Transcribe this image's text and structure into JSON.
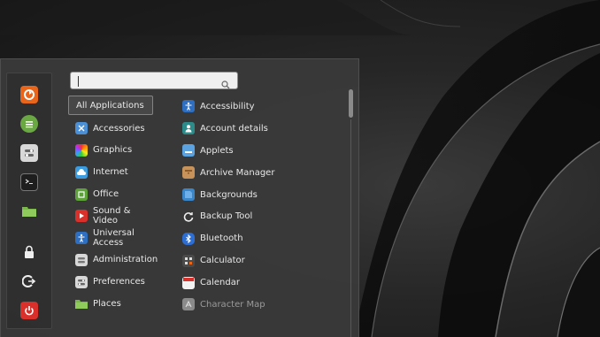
{
  "colors": {
    "mint_orange": "#e8661c",
    "green": "#7bb84b",
    "red": "#d9302b",
    "blue": "#3b85c9"
  },
  "favorites": [
    {
      "name": "firefox",
      "icon": "firefox-icon"
    },
    {
      "name": "software-manager",
      "icon": "software-manager-icon"
    },
    {
      "name": "settings",
      "icon": "toggle-settings-icon"
    },
    {
      "name": "terminal",
      "icon": "terminal-icon"
    },
    {
      "name": "files",
      "icon": "folder-icon"
    },
    {
      "name": "lock-screen",
      "icon": "lock-icon"
    },
    {
      "name": "logout",
      "icon": "logout-icon"
    },
    {
      "name": "shutdown",
      "icon": "power-icon"
    }
  ],
  "search": {
    "value": "",
    "placeholder": ""
  },
  "categories": [
    {
      "label": "All Applications",
      "selected": true
    },
    {
      "label": "Accessories",
      "icon": "accessories-icon"
    },
    {
      "label": "Graphics",
      "icon": "graphics-icon"
    },
    {
      "label": "Internet",
      "icon": "internet-icon"
    },
    {
      "label": "Office",
      "icon": "office-icon"
    },
    {
      "label": "Sound & Video",
      "icon": "sound-video-icon"
    },
    {
      "label": "Universal Access",
      "icon": "universal-access-icon"
    },
    {
      "label": "Administration",
      "icon": "administration-icon"
    },
    {
      "label": "Preferences",
      "icon": "preferences-icon"
    },
    {
      "label": "Places",
      "icon": "places-folder-icon"
    }
  ],
  "applications": [
    {
      "label": "Accessibility",
      "icon": "accessibility-icon"
    },
    {
      "label": "Account details",
      "icon": "account-icon"
    },
    {
      "label": "Applets",
      "icon": "applets-icon"
    },
    {
      "label": "Archive Manager",
      "icon": "archive-icon"
    },
    {
      "label": "Backgrounds",
      "icon": "backgrounds-icon"
    },
    {
      "label": "Backup Tool",
      "icon": "backup-icon"
    },
    {
      "label": "Bluetooth",
      "icon": "bluetooth-icon"
    },
    {
      "label": "Calculator",
      "icon": "calculator-icon"
    },
    {
      "label": "Calendar",
      "icon": "calendar-icon"
    },
    {
      "label": "Character Map",
      "icon": "character-map-icon"
    }
  ]
}
